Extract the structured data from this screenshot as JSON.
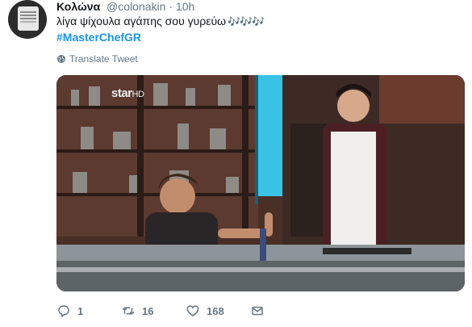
{
  "tweet": {
    "display_name": "Κολώνα",
    "handle": "@colonakin",
    "separator": "·",
    "time": "10h",
    "text": "λίγα ψίχουλα αγάπης σου γυρεύω",
    "emoji": "🎶🎶🎶",
    "hashtag": "#MasterChefGR",
    "translate_label": "Translate Tweet"
  },
  "media": {
    "watermark": "star",
    "watermark_suffix": "HD"
  },
  "actions": {
    "reply_count": "1",
    "retweet_count": "16",
    "like_count": "168"
  },
  "colors": {
    "link": "#1b95e0",
    "secondary": "#657786",
    "text": "#14171a"
  },
  "icons": [
    "globe-icon",
    "reply-icon",
    "retweet-icon",
    "like-icon",
    "direct-message-icon"
  ]
}
